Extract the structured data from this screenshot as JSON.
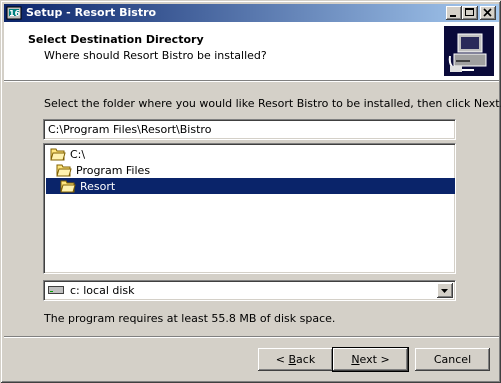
{
  "window": {
    "title": "Setup - Resort Bistro",
    "app_icon": "setup-app-icon",
    "caption_buttons": [
      "minimize-icon",
      "maximize-icon",
      "close-icon"
    ]
  },
  "header": {
    "title": "Select Destination Directory",
    "subtitle": "Where should Resort Bistro be installed?",
    "logo_icon": "computer-install-icon"
  },
  "instruction": "Select the folder where you would like Resort Bistro to be installed, then click Next.",
  "path_input": {
    "value": "C:\\Program Files\\Resort\\Bistro"
  },
  "folder_tree": {
    "items": [
      {
        "label": "C:\\",
        "icon": "open-folder-icon",
        "selected": false
      },
      {
        "label": "Program Files",
        "icon": "open-folder-icon",
        "selected": false
      },
      {
        "label": "Resort",
        "icon": "open-folder-icon",
        "selected": true
      }
    ]
  },
  "drive_select": {
    "value": "c: local disk",
    "icon": "drive-icon"
  },
  "disk_space_text": "The program requires at least 55.8 MB of disk space.",
  "buttons": {
    "back_prefix": "< ",
    "back_key": "B",
    "back_rest": "ack",
    "next_key": "N",
    "next_rest": "ext >",
    "cancel": "Cancel"
  },
  "colors": {
    "titlebar_start": "#0a246a",
    "titlebar_end": "#a6caf0",
    "selection": "#0a246a",
    "face": "#d4d0c8"
  }
}
